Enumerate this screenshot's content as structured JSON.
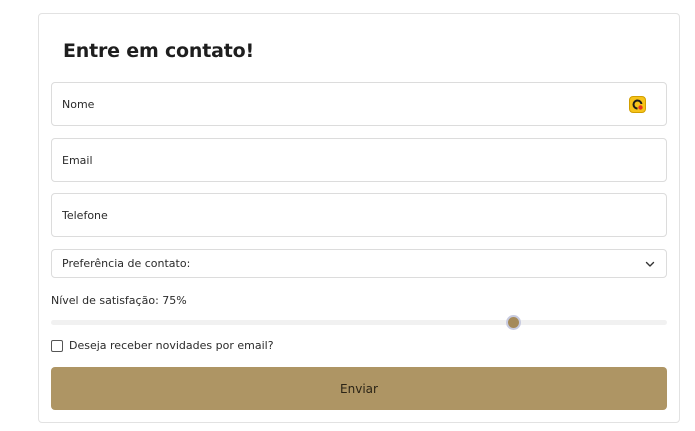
{
  "form": {
    "title": "Entre em contato!",
    "name": {
      "placeholder": "Nome",
      "value": ""
    },
    "email": {
      "placeholder": "Email",
      "value": ""
    },
    "phone": {
      "placeholder": "Telefone",
      "value": ""
    },
    "preference": {
      "label": "Preferência de contato:",
      "icon": "chevron-down-icon"
    },
    "satisfaction": {
      "label": "Nível de satisfação: 75%",
      "value_percent": 75
    },
    "newsletter": {
      "label": "Deseja receber novidades por email?",
      "checked": false
    },
    "submit_label": "Enviar",
    "autofill_icon": "password-manager-icon"
  },
  "colors": {
    "accent": "#ae9564",
    "thumb": "#a58a5a",
    "border": "#dcdcdc",
    "autofill_icon_bg": "#f6c31a"
  }
}
